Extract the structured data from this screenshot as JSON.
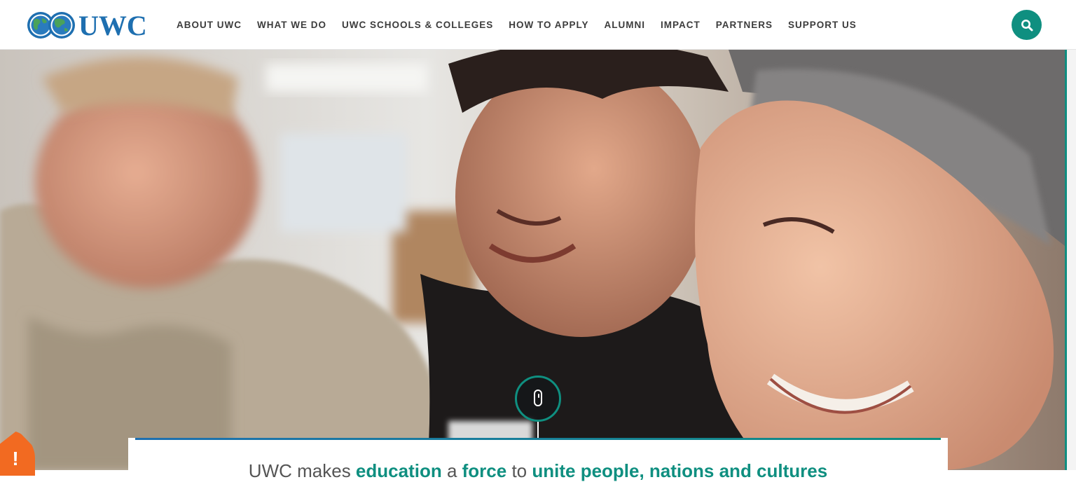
{
  "brand": {
    "logo_text": "UWC",
    "logo_color": "#1e6fb0"
  },
  "nav": {
    "items": [
      {
        "label": "ABOUT UWC"
      },
      {
        "label": "WHAT WE DO"
      },
      {
        "label": "UWC SCHOOLS & COLLEGES"
      },
      {
        "label": "HOW TO APPLY"
      },
      {
        "label": "ALUMNI"
      },
      {
        "label": "IMPACT"
      },
      {
        "label": "PARTNERS"
      },
      {
        "label": "SUPPORT US"
      }
    ],
    "search_icon": "search-icon"
  },
  "hero": {
    "image_desc": "three-students-smiling-photo",
    "scroll_icon": "mouse-scroll-icon"
  },
  "intro": {
    "parts": [
      {
        "text": "UWC makes ",
        "highlight": false
      },
      {
        "text": "education",
        "highlight": true
      },
      {
        "text": " a ",
        "highlight": false
      },
      {
        "text": "force",
        "highlight": true
      },
      {
        "text": " to ",
        "highlight": false
      },
      {
        "text": "unite people, nations and cultures",
        "highlight": true
      }
    ]
  },
  "alert": {
    "symbol": "!",
    "icon": "alert-icon",
    "color": "#f26a21"
  },
  "colors": {
    "accent": "#0f8f80",
    "brand_blue": "#1e6fb0",
    "text": "#3c3c3c"
  }
}
